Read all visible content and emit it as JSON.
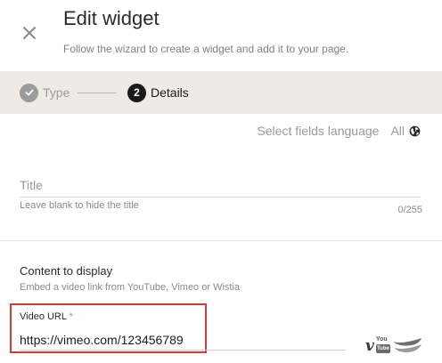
{
  "header": {
    "title": "Edit widget",
    "subtitle": "Follow the wizard to create a widget and add it to your page.",
    "close_icon": "close-icon"
  },
  "stepper": {
    "steps": [
      {
        "label": "Type",
        "state": "done",
        "icon": "check-icon"
      },
      {
        "label": "Details",
        "state": "current",
        "number": "2"
      }
    ]
  },
  "language": {
    "label": "Select fields language",
    "value": "All",
    "icon": "globe-icon"
  },
  "title_field": {
    "placeholder": "Title",
    "value": "",
    "hint": "Leave blank to hide the title",
    "counter": "0/255"
  },
  "content": {
    "heading": "Content to display",
    "description": "Embed a video link from YouTube, Vimeo or Wistia",
    "video_url_label": "Video URL",
    "required_mark": "*",
    "video_url_value": "https://vimeo.com/123456789",
    "provider_icons": [
      "vimeo-icon",
      "youtube-icon",
      "wistia-icon"
    ],
    "youtube_top": "You",
    "youtube_bottom": "Tube",
    "vimeo_letter": "v"
  },
  "colors": {
    "highlight_border": "#d23b3b",
    "stepper_bg": "#eeebe4",
    "required": "#e56f6f"
  }
}
